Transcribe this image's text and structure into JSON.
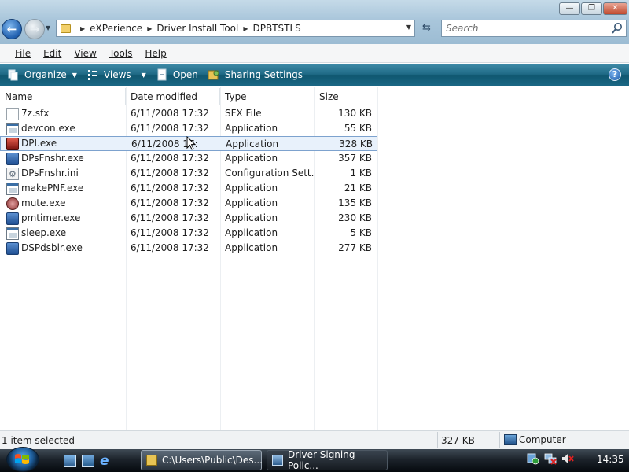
{
  "window": {
    "controls": {
      "minimize": "—",
      "maximize": "❐",
      "close": "✕"
    }
  },
  "nav": {
    "back_icon": "back-arrow-icon",
    "forward_icon": "forward-arrow-icon"
  },
  "address": {
    "crumbs": [
      "eXPerience",
      "Driver Install Tool",
      "DPBTSTLS"
    ]
  },
  "search": {
    "placeholder": "Search"
  },
  "menu": {
    "items": [
      "File",
      "Edit",
      "View",
      "Tools",
      "Help"
    ]
  },
  "commands": {
    "organize": "Organize",
    "views": "Views",
    "open": "Open",
    "sharing": "Sharing Settings",
    "help": "?"
  },
  "list": {
    "columns": [
      "Name",
      "Date modified",
      "Type",
      "Size"
    ],
    "rows": [
      {
        "name": "7z.sfx",
        "date": "6/11/2008 17:32",
        "type": "SFX File",
        "size": "130 KB",
        "icon": "document-icon"
      },
      {
        "name": "devcon.exe",
        "date": "6/11/2008 17:32",
        "type": "Application",
        "size": "55 KB",
        "icon": "application-icon"
      },
      {
        "name": "DPI.exe",
        "date": "6/11/2008 17:",
        "type": "Application",
        "size": "328 KB",
        "icon": "dpi-app-icon",
        "selected": true
      },
      {
        "name": "DPsFnshr.exe",
        "date": "6/11/2008 17:32",
        "type": "Application",
        "size": "357 KB",
        "icon": "installer-icon"
      },
      {
        "name": "DPsFnshr.ini",
        "date": "6/11/2008 17:32",
        "type": "Configuration Sett...",
        "size": "1 KB",
        "icon": "config-file-icon"
      },
      {
        "name": "makePNF.exe",
        "date": "6/11/2008 17:32",
        "type": "Application",
        "size": "21 KB",
        "icon": "application-icon"
      },
      {
        "name": "mute.exe",
        "date": "6/11/2008 17:32",
        "type": "Application",
        "size": "135 KB",
        "icon": "mute-icon"
      },
      {
        "name": "pmtimer.exe",
        "date": "6/11/2008 17:32",
        "type": "Application",
        "size": "230 KB",
        "icon": "installer-icon"
      },
      {
        "name": "sleep.exe",
        "date": "6/11/2008 17:32",
        "type": "Application",
        "size": "5 KB",
        "icon": "application-icon"
      },
      {
        "name": "DSPdsblr.exe",
        "date": "6/11/2008 17:32",
        "type": "Application",
        "size": "277 KB",
        "icon": "installer-icon"
      }
    ]
  },
  "status": {
    "selection": "1 item selected",
    "size": "327 KB",
    "zone": "Computer"
  },
  "taskbar": {
    "tasks": [
      "C:\\Users\\Public\\Des...",
      "Driver Signing Polic..."
    ],
    "clock": "14:35"
  },
  "colors": {
    "command_bar": "#1f6a86",
    "selection": "#e8f1fb",
    "taskbar": "#1c232b"
  }
}
